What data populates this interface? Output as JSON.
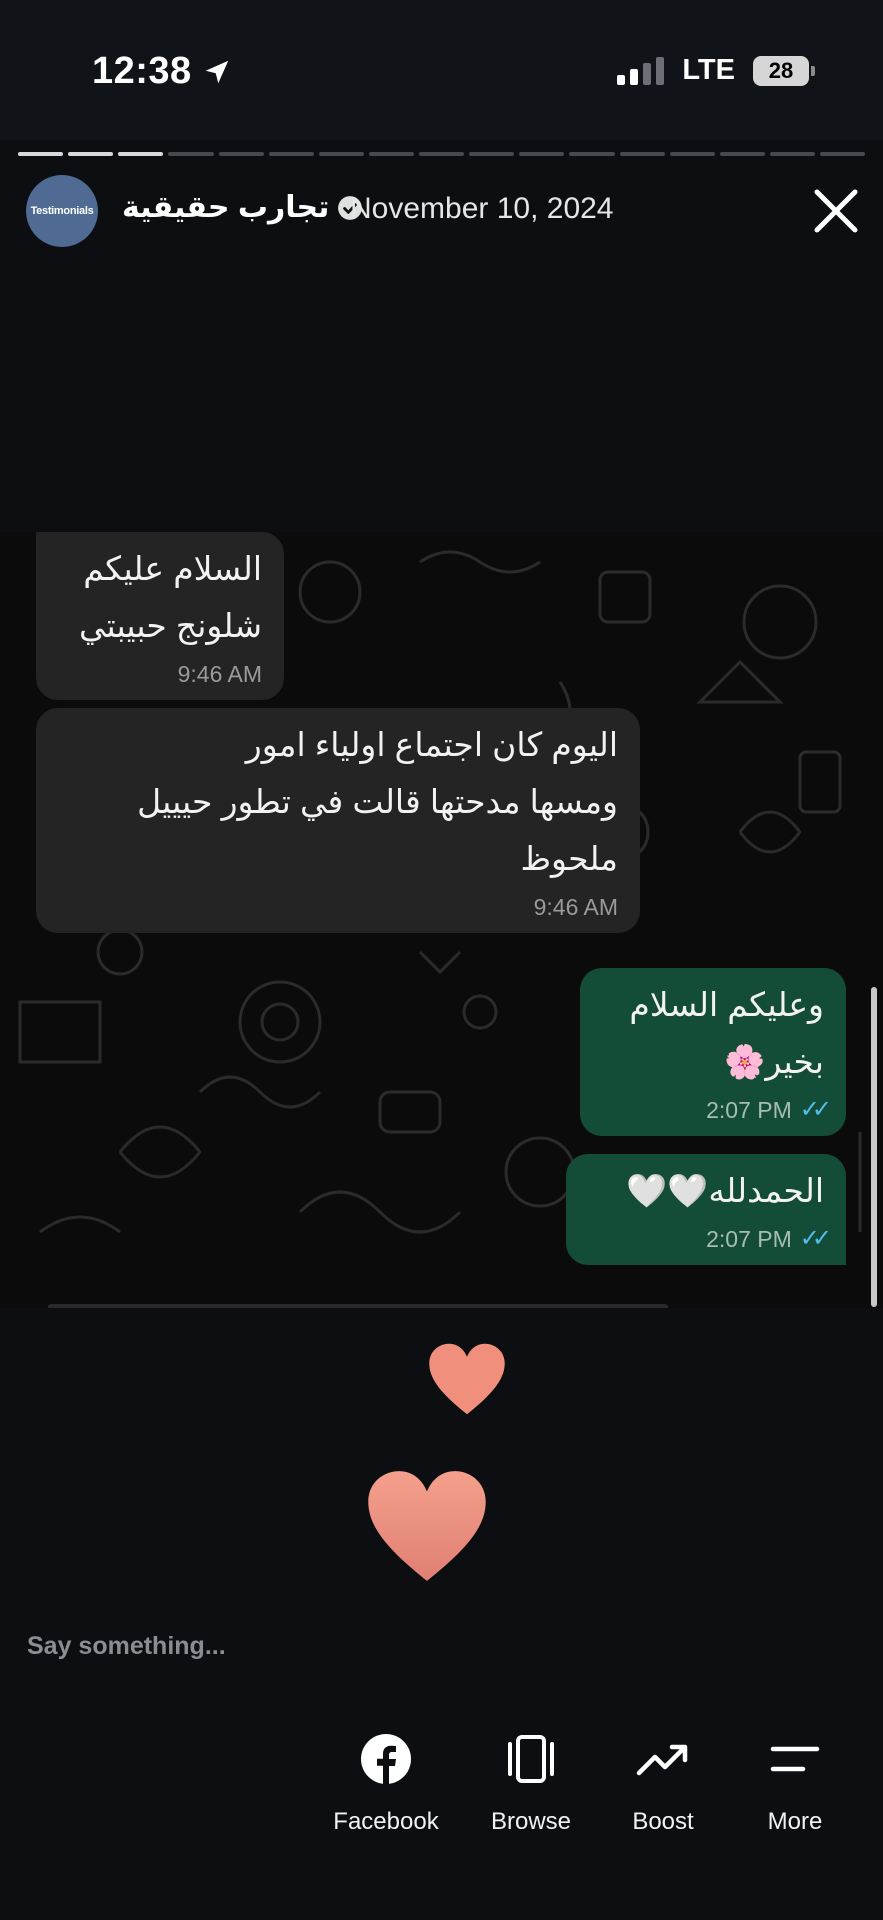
{
  "status_bar": {
    "time": "12:38",
    "network": "LTE",
    "battery": "28"
  },
  "story": {
    "progress_total": 17,
    "progress_done": 3,
    "progress_current": 4,
    "avatar_text": "Testimonials",
    "page_name": "تجارب حقيقية",
    "date": "November 10, 2024"
  },
  "chat": {
    "messages": [
      {
        "direction": "in",
        "lines": [
          "السلام عليكم",
          "شلونج حبيبتي"
        ],
        "time": "9:46 AM"
      },
      {
        "direction": "in",
        "lines": [
          "اليوم كان اجتماع اولياء امور",
          "ومسها مدحتها قالت في تطور حيييل",
          "ملحوظ"
        ],
        "time": "9:46 AM"
      },
      {
        "direction": "out",
        "lines": [
          "وعليكم السلام",
          "بخير🌸"
        ],
        "time": "2:07 PM"
      },
      {
        "direction": "out",
        "lines": [
          "الحمدلله🤍🤍"
        ],
        "time": "2:07 PM"
      }
    ]
  },
  "reply": {
    "placeholder": "Say something..."
  },
  "actions": [
    {
      "label": "Facebook",
      "icon": "facebook-icon"
    },
    {
      "label": "Browse",
      "icon": "browse-icon"
    },
    {
      "label": "Boost",
      "icon": "boost-icon"
    },
    {
      "label": "More",
      "icon": "more-icon"
    }
  ],
  "colors": {
    "background": "#0c0e12",
    "incoming_bubble": "#242424",
    "outgoing_bubble": "#144d37",
    "heart": "#f0907c",
    "read_ticks": "#53bdeb"
  }
}
